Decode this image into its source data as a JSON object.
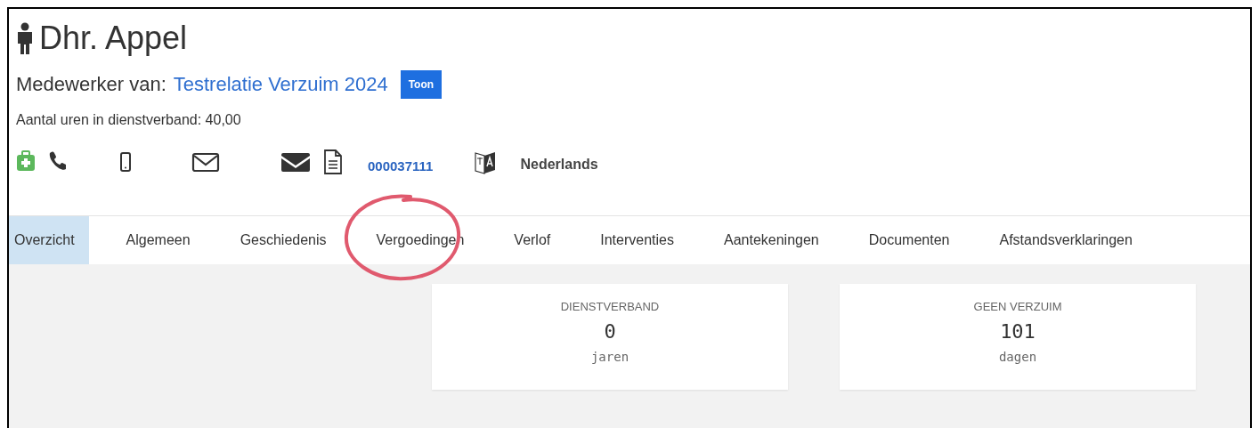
{
  "person": {
    "name": "Dhr. Appel"
  },
  "employer": {
    "label": "Medewerker van:",
    "name": "Testrelatie Verzuim 2024",
    "button": "Toon"
  },
  "hours": "Aantal uren in dienstverband: 40,00",
  "contact": {
    "number": "000037111",
    "language": "Nederlands"
  },
  "tabs": [
    {
      "label": "Overzicht",
      "selected": true,
      "circled": false
    },
    {
      "label": "Algemeen",
      "selected": false,
      "circled": false
    },
    {
      "label": "Geschiedenis",
      "selected": false,
      "circled": false
    },
    {
      "label": "Vergoedingen",
      "selected": false,
      "circled": true
    },
    {
      "label": "Verlof",
      "selected": false,
      "circled": false
    },
    {
      "label": "Interventies",
      "selected": false,
      "circled": false
    },
    {
      "label": "Aantekeningen",
      "selected": false,
      "circled": false
    },
    {
      "label": "Documenten",
      "selected": false,
      "circled": false
    },
    {
      "label": "Afstandsverklaringen",
      "selected": false,
      "circled": false
    }
  ],
  "cards": [
    {
      "title": "DIENSTVERBAND",
      "value": "0",
      "unit": "jaren"
    },
    {
      "title": "GEEN VERZUIM",
      "value": "101",
      "unit": "dagen"
    }
  ]
}
